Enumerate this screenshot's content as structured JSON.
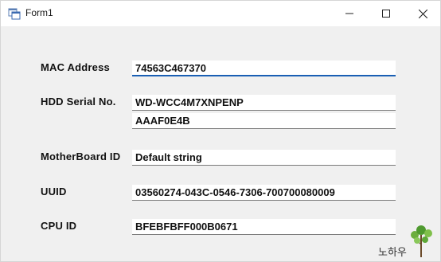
{
  "window": {
    "title": "Form1"
  },
  "fields": {
    "mac": {
      "label": "MAC Address",
      "value": "74563C467370"
    },
    "hdd": {
      "label": "HDD Serial No.",
      "value1": "WD-WCC4M7XNPENP",
      "value2": "AAAF0E4B"
    },
    "motherboard": {
      "label": "MotherBoard ID",
      "value": "Default string"
    },
    "uuid": {
      "label": "UUID",
      "value": "03560274-043C-0546-7306-700700080009"
    },
    "cpu": {
      "label": "CPU ID",
      "value": "BFEBFBFF000B0671"
    }
  },
  "watermark": {
    "text": "노하우"
  },
  "colors": {
    "focus_accent": "#1a5fb4",
    "title_bar": "#ffffff",
    "form_bg": "#f0f0f0"
  }
}
